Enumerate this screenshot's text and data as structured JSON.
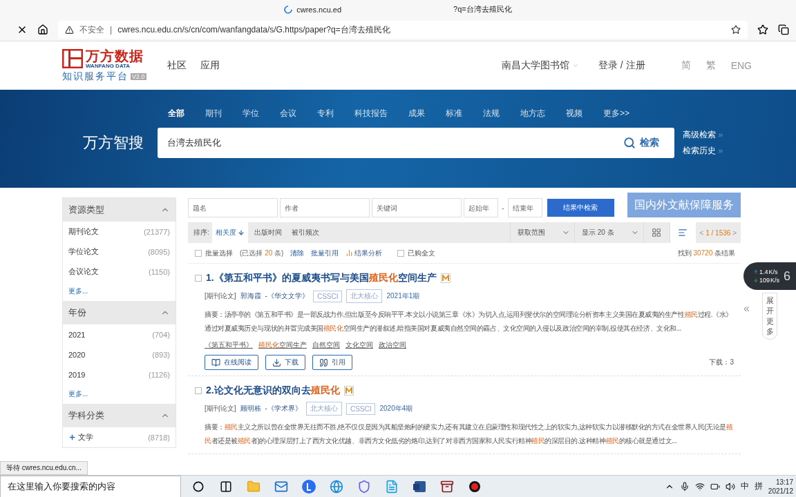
{
  "browser": {
    "title_parts": [
      "cwres.ncu.ed",
      "?q=台湾去殖民化"
    ],
    "security": "不安全",
    "separator": "|",
    "url": "cwres.ncu.edu.cn/s/cn/com/wanfangdata/s/G.https/paper?q=台湾去殖民化"
  },
  "header": {
    "logo_cn": "万方数据",
    "logo_en": "WANFANG DATA",
    "platform": "知识服务平台",
    "version": "V2.0",
    "nav": [
      "社区",
      "应用"
    ],
    "library": "南昌大学图书馆",
    "login": "登录 / 注册",
    "langs": [
      "简",
      "繁",
      "ENG"
    ]
  },
  "banner": {
    "categories": [
      {
        "label": "全部",
        "selected": true
      },
      {
        "label": "期刊",
        "selected": false
      },
      {
        "label": "学位",
        "selected": false
      },
      {
        "label": "会议",
        "selected": false
      },
      {
        "label": "专利",
        "selected": false
      },
      {
        "label": "科技报告",
        "selected": false
      },
      {
        "label": "成果",
        "selected": false
      },
      {
        "label": "标准",
        "selected": false
      },
      {
        "label": "法规",
        "selected": false
      },
      {
        "label": "地方志",
        "selected": false
      },
      {
        "label": "视频",
        "selected": false
      },
      {
        "label": "更多>>",
        "selected": false
      }
    ],
    "brand": "万方智搜",
    "query": "台湾去殖民化",
    "search_button": "检索",
    "links": [
      "高级检索",
      "检索历史"
    ]
  },
  "filters": {
    "fields": [
      {
        "placeholder": "题名"
      },
      {
        "placeholder": "作者"
      },
      {
        "placeholder": "关键词"
      },
      {
        "placeholder": "起始年"
      },
      {
        "placeholder": "结束年"
      }
    ],
    "dash": "-",
    "submit": "结果中检索",
    "service": "国内外文献保障服务"
  },
  "sidebar": [
    {
      "title": "资源类型",
      "expanded": true,
      "items": [
        {
          "label": "期刊论文",
          "count": "(21377)",
          "expandable": false
        },
        {
          "label": "学位论文",
          "count": "(8095)",
          "expandable": false
        },
        {
          "label": "会议论文",
          "count": "(1150)",
          "expandable": false
        }
      ],
      "more": "更多..."
    },
    {
      "title": "年份",
      "expanded": true,
      "items": [
        {
          "label": "2021",
          "count": "(704)",
          "expandable": false
        },
        {
          "label": "2020",
          "count": "(893)",
          "expandable": false
        },
        {
          "label": "2019",
          "count": "(1126)",
          "expandable": false
        }
      ],
      "more": "更多..."
    },
    {
      "title": "学科分类",
      "expanded": true,
      "items": [
        {
          "label": "文学",
          "count": "(8718)",
          "expandable": true
        }
      ]
    }
  ],
  "sort": {
    "label": "排序:",
    "options": [
      {
        "label": "相关度",
        "selected": true
      },
      {
        "label": "出版时间",
        "selected": false
      },
      {
        "label": "被引频次",
        "selected": false
      }
    ],
    "range": "获取范围",
    "display": "显示 20 条",
    "view_modes": [
      {
        "kind": "grid",
        "selected": false
      },
      {
        "kind": "list",
        "selected": true
      }
    ],
    "prev": "<",
    "page": "1 / 1536",
    "next": ">"
  },
  "batch": {
    "select": "批量选择",
    "select_checked": false,
    "purchased_checked": false,
    "selected_prefix": "(已选择",
    "selected_count": "20",
    "selected_suffix": "条)",
    "clear": "清除",
    "cite": "批量引用",
    "analysis": "结果分析",
    "purchased": "已购全文",
    "found_prefix": "找到",
    "found_count": "30720",
    "found_suffix": "条结果"
  },
  "results": [
    {
      "checked": false,
      "title": [
        {
          "text": "1.《第五和平书》的夏威夷书写与美国",
          "hl": false
        },
        {
          "text": "殖民化",
          "hl": true
        },
        {
          "text": "空间生产",
          "hl": false
        }
      ],
      "type": "[期刊论文]",
      "author": "郭海霞",
      "journal": "-《华文文学》",
      "tags": [
        "CSSCI",
        "北大核心"
      ],
      "issue": "2021年1期",
      "abstract": [
        {
          "text": "摘要：汤亭亭的《第五和平书》是一部反战力作,但出版至今反响平平.本文以小说第三章《水》为切入点,运用列斐伏尔的空间理论分析资本主义美国在夏威夷的生产性",
          "hl": false
        },
        {
          "text": "殖民",
          "hl": true
        },
        {
          "text": "过程.《水》通过对夏威夷历史与现状的并置完成美国",
          "hl": false
        },
        {
          "text": "殖民化",
          "hl": true
        },
        {
          "text": "空间生产的潜叙述,暗指美国对夏威夷自然空间的霸占、文化空间的入侵以及政治空间的宰制,役使其在经济、文化和...",
          "hl": false
        }
      ],
      "keywords": [
        [
          {
            "text": "《第五和平书》",
            "hl": false
          }
        ],
        [
          {
            "text": "殖民化",
            "hl": true
          },
          {
            "text": "空间生产",
            "hl": false
          }
        ],
        [
          {
            "text": "自然空间",
            "hl": false
          }
        ],
        [
          {
            "text": "文化空间",
            "hl": false
          }
        ],
        [
          {
            "text": "政治空间",
            "hl": false
          }
        ]
      ],
      "actions": [
        {
          "kind": "read",
          "label": "在线阅读"
        },
        {
          "kind": "download",
          "label": "下载"
        },
        {
          "kind": "cite",
          "label": "引用"
        }
      ],
      "downloads": "下载：3"
    },
    {
      "checked": false,
      "title": [
        {
          "text": "2.论文化无意识的双向去",
          "hl": false
        },
        {
          "text": "殖民化",
          "hl": true
        }
      ],
      "type": "[期刊论文]",
      "author": "顾明栋",
      "journal": "-《学术界》",
      "tags": [
        "北大核心",
        "CSSCI"
      ],
      "issue": "2020年4期",
      "abstract": [
        {
          "text": "摘要：",
          "hl": false
        },
        {
          "text": "殖民",
          "hl": true
        },
        {
          "text": "主义之所以曾在全世界无往而不胜,绝不仅仅是因为其船坚炮利的硬实力,还有其建立在启蒙理性和现代性之上的软实力,这种软实力以潜移默化的方式在全世界人民(无论是",
          "hl": false
        },
        {
          "text": "殖民",
          "hl": true
        },
        {
          "text": "者还是被",
          "hl": false
        },
        {
          "text": "殖民",
          "hl": true
        },
        {
          "text": "者)的心理深层打上了西方文化优越、非西方文化低劣的烙印,达到了对非西方国家和人民实行精神",
          "hl": false
        },
        {
          "text": "殖民",
          "hl": true
        },
        {
          "text": "的深层目的.这种精神",
          "hl": false
        },
        {
          "text": "殖民",
          "hl": true
        },
        {
          "text": "的核心就是通过文...",
          "hl": false
        }
      ]
    }
  ],
  "side_tab": {
    "arrow": "«",
    "label": "展开更多"
  },
  "speed_widget": {
    "up": "1.4",
    "up_unit": "K/s",
    "down": "109",
    "down_unit": "K/s",
    "badge": "6"
  },
  "status": "等待 cwres.ncu.edu.cn...",
  "taskbar": {
    "search_placeholder": "在这里输入你要搜索的内容",
    "apps": [
      {
        "kind": "cortana"
      },
      {
        "kind": "taskview"
      },
      {
        "kind": "folder"
      },
      {
        "kind": "mail"
      },
      {
        "kind": "letter"
      },
      {
        "kind": "edge"
      },
      {
        "kind": "shield"
      },
      {
        "kind": "files"
      },
      {
        "kind": "word"
      },
      {
        "kind": "archive"
      },
      {
        "kind": "record"
      }
    ],
    "ime": "中",
    "ime_mode": "拼",
    "time": "13:17",
    "date": "2021/12"
  }
}
